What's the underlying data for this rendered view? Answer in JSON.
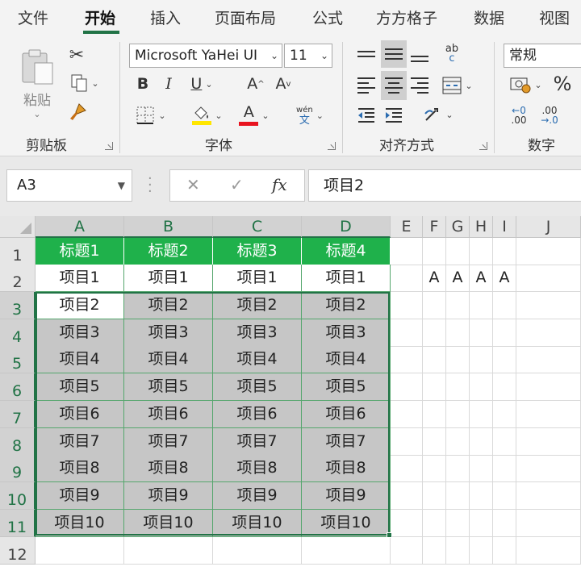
{
  "tabs": [
    "文件",
    "开始",
    "插入",
    "页面布局",
    "公式",
    "方方格子",
    "数据",
    "视图"
  ],
  "active_tab": "开始",
  "ribbon": {
    "clipboard": {
      "label": "剪贴板",
      "paste_label": "粘贴"
    },
    "font": {
      "label": "字体",
      "font_name": "Microsoft YaHei UI",
      "font_size": "11",
      "bold": "B",
      "italic": "I",
      "underline": "U",
      "grow": "A",
      "shrink": "A",
      "font_color_letter": "A",
      "phonetic_top": "wén",
      "phonetic_bottom": "文",
      "fill_color": "#ffe600",
      "font_color": "#e8131f"
    },
    "alignment": {
      "label": "对齐方式",
      "wrap": "ab",
      "wrap2": "c"
    },
    "number": {
      "label": "数字",
      "format": "常规",
      "percent": "%",
      "inc_dec_top": "←0",
      "inc_dec_sub": ".00",
      "dec_top": ".00",
      "dec_sub": "→.0"
    }
  },
  "formula_bar": {
    "name_box": "A3",
    "cancel": "✕",
    "enter": "✓",
    "fx": "fx",
    "value": "项目2"
  },
  "sheet": {
    "columns": [
      "A",
      "B",
      "C",
      "D",
      "E",
      "F",
      "G",
      "H",
      "I",
      "J"
    ],
    "rows": [
      "1",
      "2",
      "3",
      "4",
      "5",
      "6",
      "7",
      "8",
      "9",
      "10",
      "11",
      "12"
    ],
    "header_row": [
      "标题1",
      "标题2",
      "标题3",
      "标题4"
    ],
    "data_rows": [
      [
        "项目1",
        "项目1",
        "项目1",
        "项目1"
      ],
      [
        "项目2",
        "项目2",
        "项目2",
        "项目2"
      ],
      [
        "项目3",
        "项目3",
        "项目3",
        "项目3"
      ],
      [
        "项目4",
        "项目4",
        "项目4",
        "项目4"
      ],
      [
        "项目5",
        "项目5",
        "项目5",
        "项目5"
      ],
      [
        "项目6",
        "项目6",
        "项目6",
        "项目6"
      ],
      [
        "项目7",
        "项目7",
        "项目7",
        "项目7"
      ],
      [
        "项目8",
        "项目8",
        "项目8",
        "项目8"
      ],
      [
        "项目9",
        "项目9",
        "项目9",
        "项目9"
      ],
      [
        "项目10",
        "项目10",
        "项目10",
        "项目10"
      ]
    ],
    "row2_extra": [
      "A",
      "A",
      "A",
      "A"
    ],
    "header_fill": "#1fb14b",
    "selection_fill": "#c6c6c6",
    "accent": "#217346"
  }
}
